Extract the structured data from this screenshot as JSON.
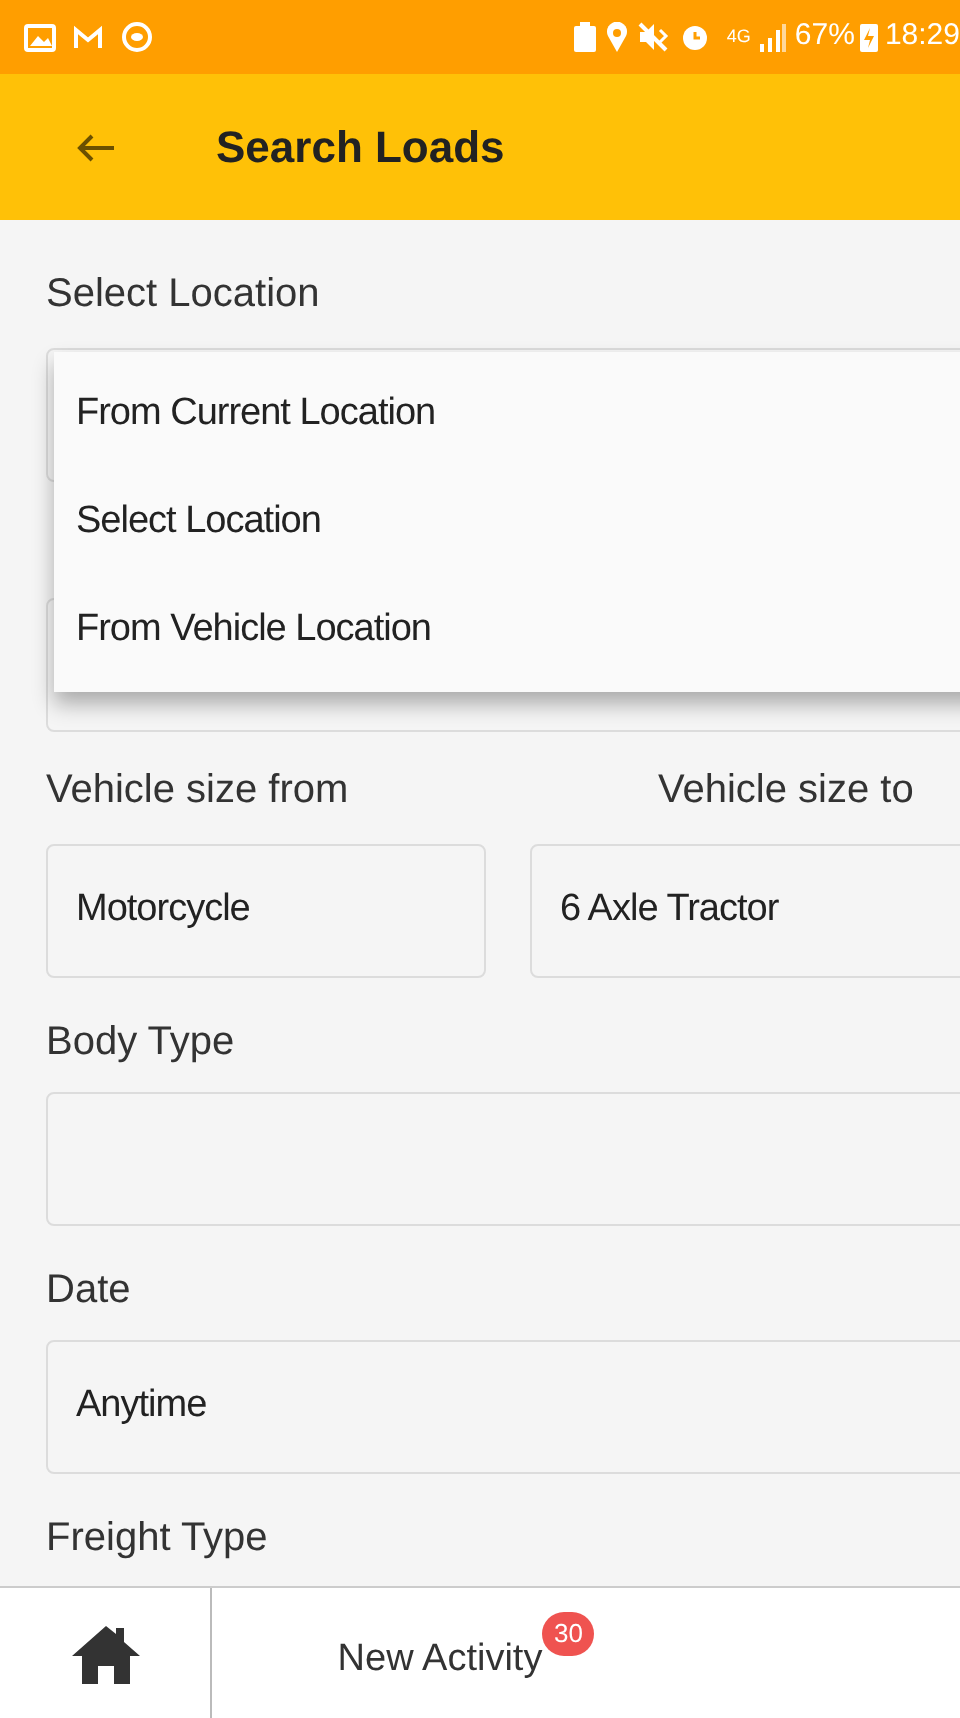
{
  "status_bar": {
    "network": "4G",
    "battery": "67%",
    "time": "18:29"
  },
  "app_bar": {
    "title": "Search Loads"
  },
  "location": {
    "label": "Select Location",
    "dropdown": {
      "expanded": true,
      "options": [
        "From Current Location",
        "Select Location",
        "From Vehicle Location"
      ]
    }
  },
  "vehicle_size": {
    "from_label": "Vehicle size from",
    "to_label": "Vehicle size to",
    "from_value": "Motorcycle",
    "to_value": "6 Axle Tractor"
  },
  "fields": [
    {
      "label": "Body Type"
    },
    {
      "label": "Date",
      "value": "Anytime"
    },
    {
      "label": "Freight Type"
    }
  ],
  "bottom_nav": {
    "label": "New Activity",
    "badge": "30"
  }
}
